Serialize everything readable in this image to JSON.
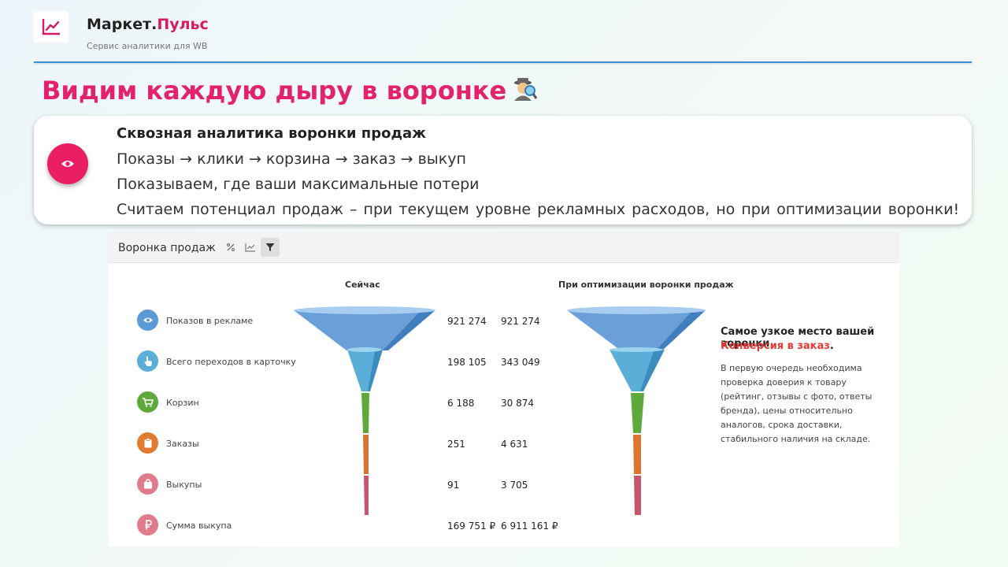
{
  "header": {
    "brand_main": "Маркет.",
    "brand_accent": "Пульс",
    "subtitle": "Сервис аналитики для WB"
  },
  "headline": "Видим каждую дыру в воронке",
  "card": {
    "title": "Сквозная аналитика воронки продаж",
    "line1": "Показы → клики → корзина → заказ → выкуп",
    "line2": "Показываем, где ваши максимальные потери",
    "line3": "Считаем потенциал продаж – при текущем уровне рекламных расходов, но при оптимизации воронки!"
  },
  "widget": {
    "title": "Воронка продаж",
    "col_now": "Сейчас",
    "col_opt": "При оптимизации воронки продаж",
    "rows": [
      {
        "label": "Показов в рекламе",
        "now": "921 274",
        "opt": "921 274",
        "icon": "eye-icon",
        "color": "#5b9bd5"
      },
      {
        "label": "Всего переходов в карточку",
        "now": "198 105",
        "opt": "343 049",
        "icon": "pointer-icon",
        "color": "#5aaed8"
      },
      {
        "label": "Корзин",
        "now": "6 188",
        "opt": "30 874",
        "icon": "cart-icon",
        "color": "#5ea83c"
      },
      {
        "label": "Заказы",
        "now": "251",
        "opt": "4 631",
        "icon": "clipboard-icon",
        "color": "#e07b30"
      },
      {
        "label": "Выкупы",
        "now": "91",
        "opt": "3 705",
        "icon": "bag-icon",
        "color": "#e07b8c"
      },
      {
        "label": "Сумма выкупа",
        "now": "169 751 ₽",
        "opt": "6 911 161 ₽",
        "icon": "ruble-icon",
        "color": "#e07b8c"
      }
    ],
    "side": {
      "title": "Самое узкое место вашей воронки",
      "accent": "Конверсия в заказ",
      "accent_suffix": ".",
      "body": "В первую очередь необходима проверка доверия к товару (рейтинг, отзывы с фото, ответы бренда), цены относительно аналогов, срока доставки, стабильного наличия на складе."
    }
  },
  "colors": {
    "brand_pink": "#e2226d",
    "header_line": "#3b8ed6",
    "funnel_blue_top": "#6a9fd8",
    "funnel_light_blue": "#5aaed8",
    "funnel_green": "#5ea83c",
    "funnel_orange": "#d97530",
    "funnel_pink": "#c4566e"
  }
}
